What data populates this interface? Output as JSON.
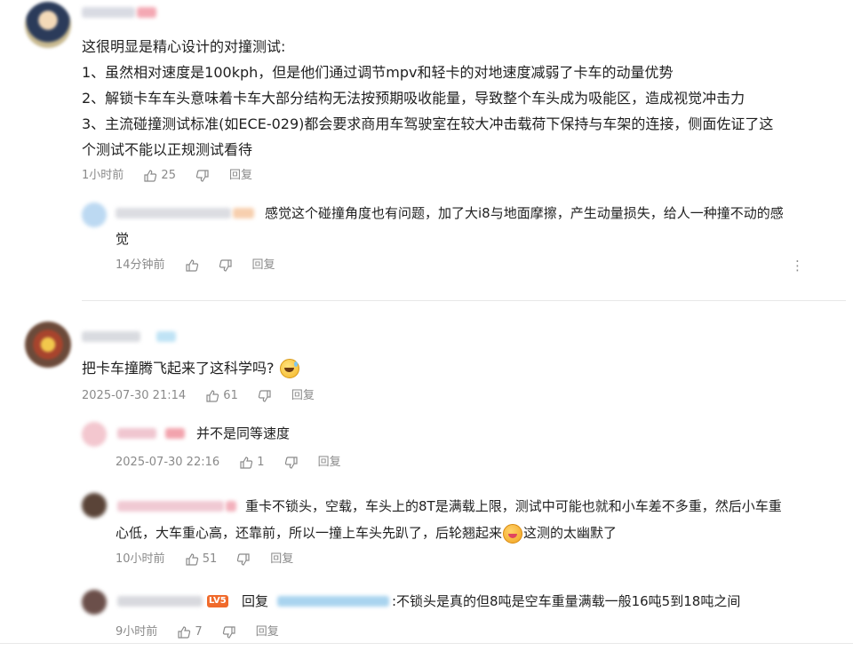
{
  "comments": [
    {
      "time": "1小时前",
      "likes": "25",
      "reply_label": "回复",
      "lines": [
        "这很明显是精心设计的对撞测试:",
        "1、虽然相对速度是100kph，但是他们通过调节mpv和轻卡的对地速度减弱了卡车的动量优势",
        "2、解锁卡车车头意味着卡车大部分结构无法按预期吸收能量，导致整个车头成为吸能区，造成视觉冲击力",
        "3、主流碰撞测试标准(如ECE-029)都会要求商用车驾驶室在较大冲击载荷下保持与车架的连接，侧面佐证了这",
        "个测试不能以正规测试看待"
      ],
      "replies": [
        {
          "lines": [
            "感觉这个碰撞角度也有问题，加了大i8与地面摩擦，产生动量损失，给人一种撞不动的感",
            "觉"
          ],
          "time": "14分钟前",
          "likes": "",
          "reply_label": "回复",
          "more": "⋮"
        }
      ]
    },
    {
      "time": "2025-07-30 21:14",
      "likes": "61",
      "reply_label": "回复",
      "lines": [
        "把卡车撞腾飞起来了这科学吗?"
      ],
      "replies": [
        {
          "lines": [
            "并不是同等速度"
          ],
          "time": "2025-07-30 22:16",
          "likes": "1",
          "reply_label": "回复"
        },
        {
          "lines": [
            "重卡不锁头，空载，车头上的8T是满载上限，测试中可能也就和小车差不多重，然后小车重",
            "心低，大车重心高，还靠前，所以一撞上车头先趴了，后轮翘起来",
            "这测的太幽默了"
          ],
          "time": "10小时前",
          "likes": "51",
          "reply_label": "回复"
        },
        {
          "reply_prefix": "回复",
          "text": ":不锁头是真的但8吨是空车重量满载一般16吨5到18吨之间",
          "badge": "LV5",
          "time": "9小时前",
          "likes": "7",
          "reply_label": "回复"
        }
      ]
    }
  ],
  "icons": {
    "like": "thumbs-up-icon",
    "dislike": "thumbs-down-icon",
    "emoji": "laughing-sweat-emoji-icon"
  },
  "colors": {
    "meta": "#8a8a8a",
    "text": "#1f1f1f",
    "badge": "#f06a2b"
  }
}
